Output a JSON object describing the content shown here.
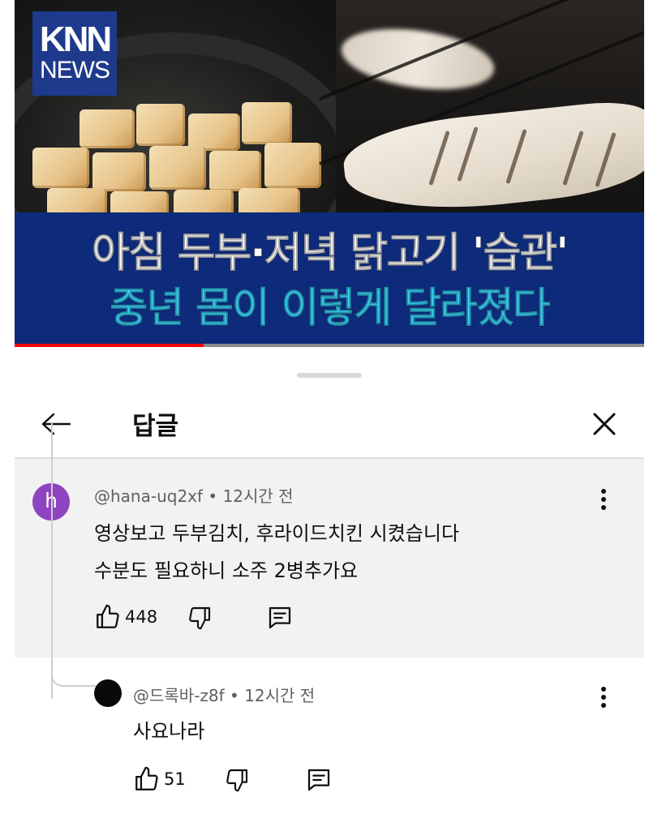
{
  "video": {
    "channel_logo_main": "KNN",
    "channel_logo_sub": "NEWS",
    "headline_line1": "아침 두부·저녁 닭고기 '습관'",
    "headline_line2": "중년 몸이 이렇게 달라졌다",
    "progress": 0.3
  },
  "sheet": {
    "title": "답글",
    "back_icon": "arrow-left-icon",
    "close_icon": "close-icon"
  },
  "comments": [
    {
      "author": "@hana-uq2xf",
      "time": "• 12시간 전",
      "avatar_letter": "h",
      "avatar_color": "#8e44c0",
      "lines": [
        "영상보고 두부김치, 후라이드치킨 시켰습니다",
        "수분도 필요하니 소주 2병추가요"
      ],
      "likes": "448"
    },
    {
      "author": "@드록바-z8f",
      "time": "• 12시간 전",
      "avatar_color": "#0a0a0a",
      "lines": [
        "사요나라"
      ],
      "likes": "51"
    }
  ],
  "colors": {
    "headline_white": "#ffffff",
    "headline_cyan": "#39d7ff",
    "headline_band": "#0e2a7a",
    "logo_bg": "#1e3a8c",
    "comment_bg": "#f2f2f2"
  }
}
